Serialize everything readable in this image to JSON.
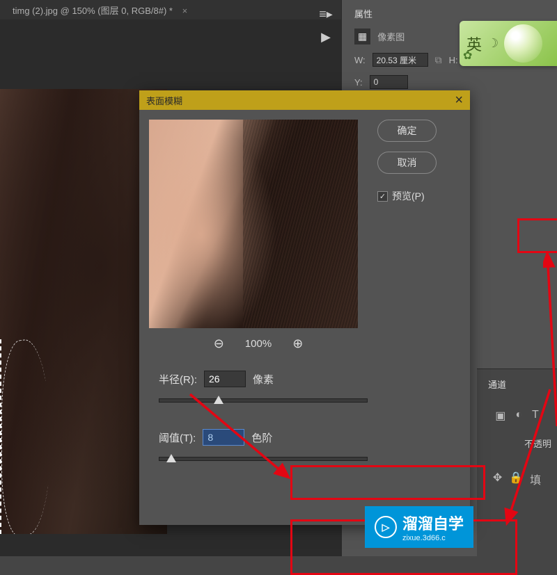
{
  "tab": {
    "title": "timg (2).jpg @ 150% (图层 0, RGB/8#) *",
    "close": "×"
  },
  "panel": {
    "title": "属性",
    "pixel_label": "像素图",
    "w_label": "W:",
    "w_value": "20.53 厘米",
    "h_label": "H:",
    "y_label": "Y:",
    "y_value": "0"
  },
  "ime": {
    "char": "英",
    "moon": "☽",
    "gear": "✿",
    "semicolon": "；"
  },
  "dialog": {
    "title": "表面模糊",
    "ok": "确定",
    "cancel": "取消",
    "preview": "预览(P)",
    "zoom": "100%",
    "radius_label": "半径(R):",
    "radius_value": "26",
    "radius_unit": "像素",
    "thresh_label": "阈值(T):",
    "thresh_value": "8",
    "thresh_unit": "色阶"
  },
  "channels": {
    "tab": "通道",
    "opacity": "不透明",
    "fill": "填"
  },
  "watermark": {
    "text": "溜溜自学",
    "sub": "zixue.3d66.c"
  },
  "icons": {
    "zoom_out": "⊖",
    "zoom_in": "⊕",
    "check": "✓",
    "play": "▶",
    "link": "⌘"
  }
}
